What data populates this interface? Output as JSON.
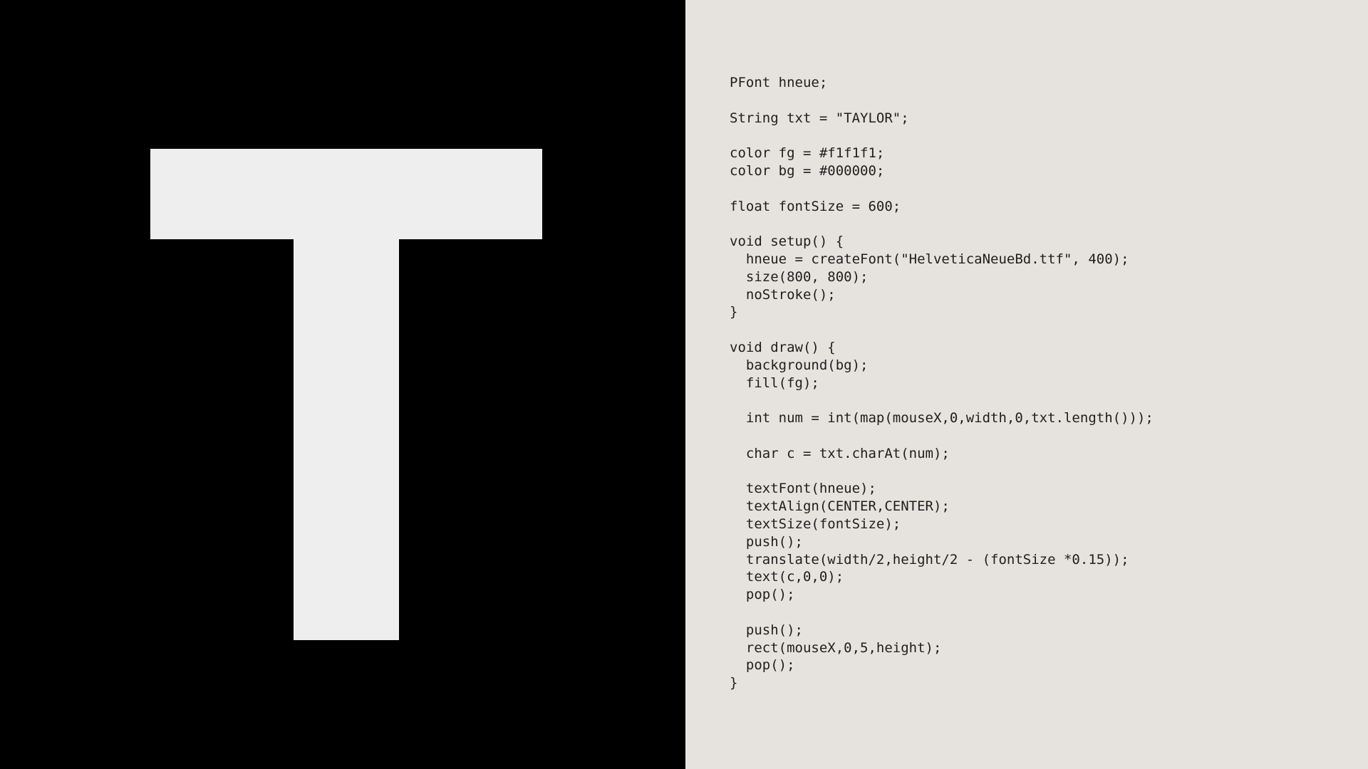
{
  "canvas": {
    "character": "T",
    "foreground": "#eeeeee",
    "background": "#000000"
  },
  "code_panel": {
    "background": "#e6e3df",
    "text_color": "#1e1e1e",
    "lines": [
      "PFont hneue;",
      "",
      "String txt = \"TAYLOR\";",
      "",
      "color fg = #f1f1f1;",
      "color bg = #000000;",
      "",
      "float fontSize = 600;",
      "",
      "void setup() {",
      "  hneue = createFont(\"HelveticaNeueBd.ttf\", 400);",
      "  size(800, 800);",
      "  noStroke();",
      "}",
      "",
      "void draw() {",
      "  background(bg);",
      "  fill(fg);",
      "",
      "  int num = int(map(mouseX,0,width,0,txt.length()));",
      "",
      "  char c = txt.charAt(num);",
      "",
      "  textFont(hneue);",
      "  textAlign(CENTER,CENTER);",
      "  textSize(fontSize);",
      "  push();",
      "  translate(width/2,height/2 - (fontSize *0.15));",
      "  text(c,0,0);",
      "  pop();",
      "",
      "  push();",
      "  rect(mouseX,0,5,height);",
      "  pop();",
      "}"
    ]
  }
}
